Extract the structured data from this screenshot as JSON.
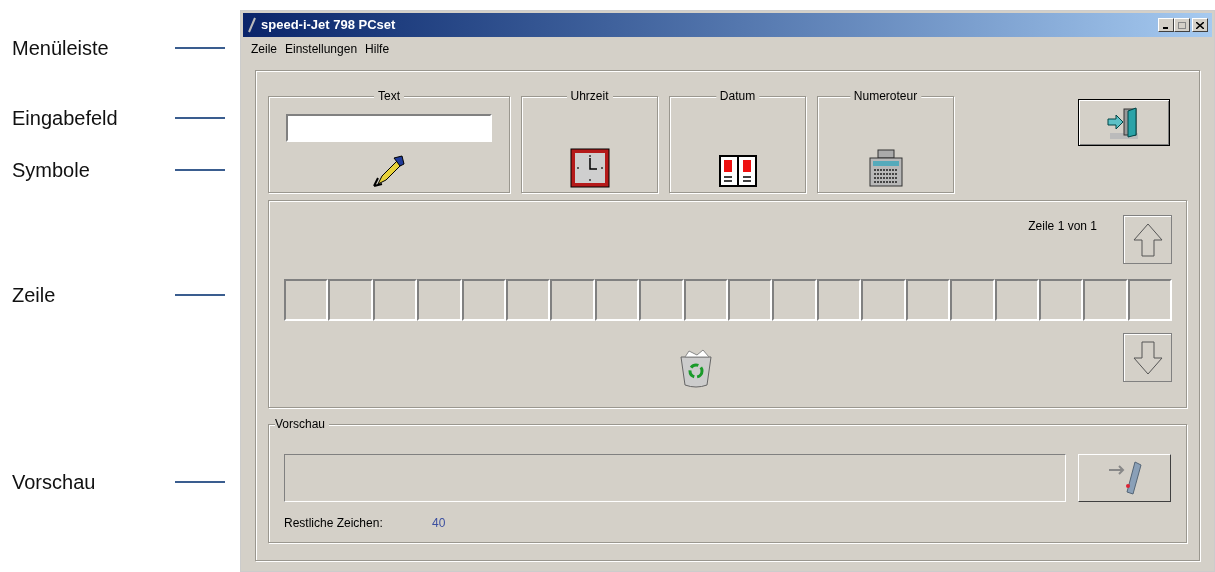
{
  "callouts": [
    {
      "label": "Menüleiste"
    },
    {
      "label": "Eingabefeld"
    },
    {
      "label": "Symbole"
    },
    {
      "label": "Zeile"
    },
    {
      "label": "Vorschau"
    }
  ],
  "window": {
    "title": "speed-i-Jet 798 PCset"
  },
  "menu": [
    "Zeile",
    "Einstellungen",
    "Hilfe"
  ],
  "groups": [
    {
      "title": "Text",
      "kind": "text"
    },
    {
      "title": "Uhrzeit",
      "kind": "clock"
    },
    {
      "title": "Datum",
      "kind": "date"
    },
    {
      "title": "Numeroteur",
      "kind": "counter"
    }
  ],
  "line_panel": {
    "position": "Zeile 1 von 1"
  },
  "preview": {
    "title": "Vorschau",
    "remaining_label": "Restliche Zeichen:",
    "remaining_value": "40"
  }
}
